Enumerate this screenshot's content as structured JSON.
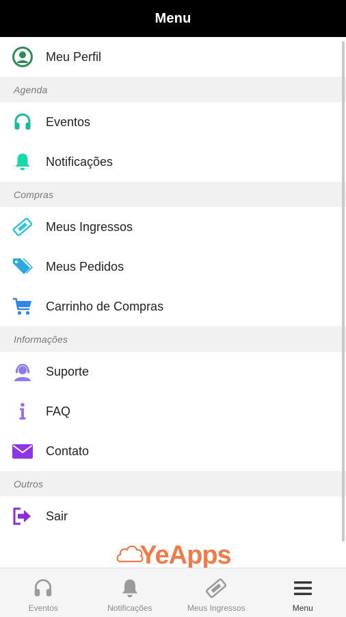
{
  "header": {
    "title": "Menu"
  },
  "menu": {
    "profile": {
      "label": "Meu Perfil",
      "icon": "user-circle-icon",
      "color": "#2e8b57"
    },
    "sections": [
      {
        "title": "Agenda",
        "items": [
          {
            "label": "Eventos",
            "icon": "headphones-icon",
            "color": "#1bb8a0"
          },
          {
            "label": "Notificações",
            "icon": "bell-icon",
            "color": "#19d9a9"
          }
        ]
      },
      {
        "title": "Compras",
        "items": [
          {
            "label": "Meus Ingressos",
            "icon": "ticket-icon",
            "color": "#2fc4d9"
          },
          {
            "label": "Meus Pedidos",
            "icon": "tags-icon",
            "color": "#29a9e0"
          },
          {
            "label": "Carrinho de Compras",
            "icon": "cart-icon",
            "color": "#2f86e6"
          }
        ]
      },
      {
        "title": "Informações",
        "items": [
          {
            "label": "Suporte",
            "icon": "support-agent-icon",
            "color": "#8a7cf0"
          },
          {
            "label": "FAQ",
            "icon": "info-icon",
            "color": "#9b6cf0"
          },
          {
            "label": "Contato",
            "icon": "envelope-icon",
            "color": "#8e35e8"
          }
        ]
      },
      {
        "title": "Outros",
        "items": [
          {
            "label": "Sair",
            "icon": "sign-out-icon",
            "color": "#8d2ae0"
          }
        ]
      }
    ]
  },
  "logo": {
    "text": "YeApps",
    "color": "#f07a4a"
  },
  "bottom_nav": [
    {
      "label": "Eventos",
      "icon": "headphones-icon",
      "active": false
    },
    {
      "label": "Notificações",
      "icon": "bell-icon",
      "active": false
    },
    {
      "label": "Meus Ingressos",
      "icon": "ticket-icon",
      "active": false
    },
    {
      "label": "Menu",
      "icon": "hamburger-menu-icon",
      "active": true
    }
  ]
}
